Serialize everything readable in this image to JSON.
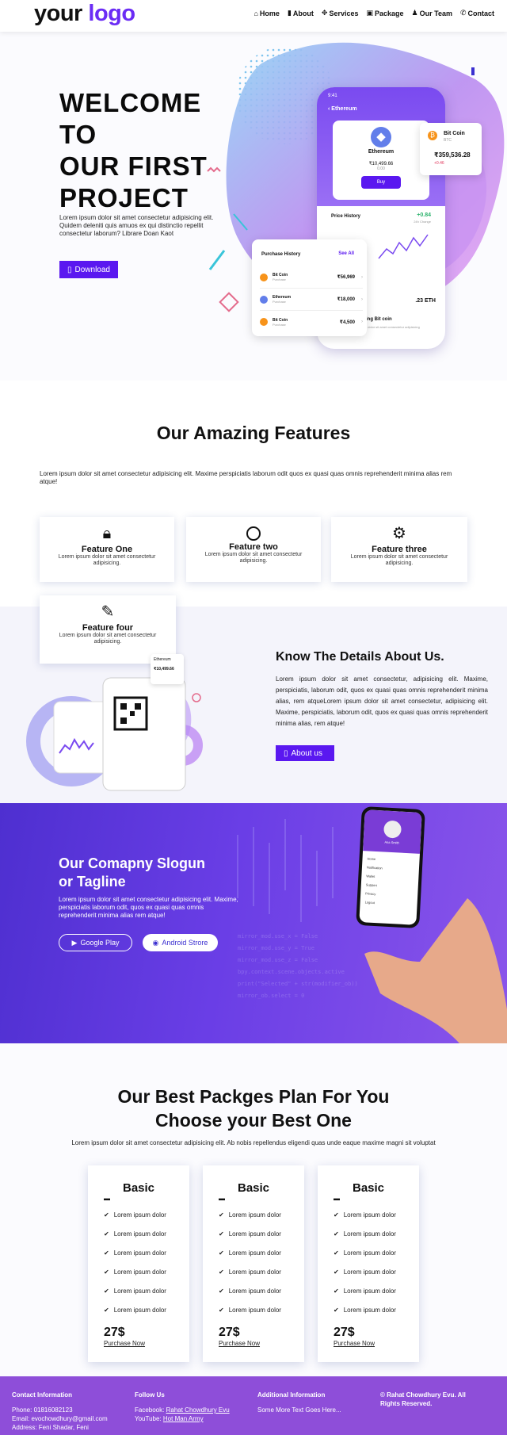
{
  "nav": {
    "logo_part1": "your",
    "logo_part2": "logo",
    "items": [
      "Home",
      "About",
      "Services",
      "Package",
      "Our Team",
      "Contact"
    ]
  },
  "hero": {
    "title_lines": [
      "WELCOME",
      "TO",
      "OUR FIRST",
      "PROJECT"
    ],
    "desc": "Lorem ipsum dolor sit amet consectetur adipisicing elit. Quidem deleniti quis amuos ex qui distinctio repellit consectetur laborum? Librare Doan Kaot",
    "download_label": "Download",
    "phone": {
      "time": "9:41",
      "coin_name": "Ethereum",
      "coin_sub": "Ethereum",
      "coin_price": "₹10,499.66",
      "coin_change": "0.00",
      "buy_label": "Buy",
      "history_label": "Price History",
      "history_value": "+0.84",
      "history_sub": "24h Change",
      "bottom_value": ".23 ETH",
      "bottom_title": "Pre Selling Bit coin",
      "bottom_sub": "Lorem ipsum dolor sit amet consectetur adipisicing"
    },
    "bitcoin_card": {
      "name": "Bit Coin",
      "sub": "BTC",
      "price": "₹359,536.28",
      "change": "+0.46"
    },
    "purchase": {
      "title": "Purchase History",
      "see_all": "See All",
      "rows": [
        {
          "name": "Bit Coin",
          "sub": "Purchase",
          "amount": "₹56,969"
        },
        {
          "name": "Ethereum",
          "sub": "Purchase",
          "amount": "₹18,000"
        },
        {
          "name": "Bit Coin",
          "sub": "Purchase",
          "amount": "₹4,500"
        }
      ]
    }
  },
  "features": {
    "title": "Our Amazing Features",
    "desc": "Lorem ipsum dolor sit amet consectetur adipisicing elit. Maxime perspiciatis laborum odit quos ex quasi quas omnis reprehenderit minima alias rem atque!",
    "cards": [
      {
        "icon": "lock-icon",
        "title": "Feature One",
        "desc": "Lorem ipsum dolor sit amet consectetur adipisicing."
      },
      {
        "icon": "circle-icon",
        "title": "Feature two",
        "desc": "Lorem ipsum dolor sit amet consectetur adipisicing."
      },
      {
        "icon": "gears-icon",
        "title": "Feature three",
        "desc": "Lorem ipsum dolor sit amet consectetur adipisicing."
      },
      {
        "icon": "file-edit-icon",
        "title": "Feature four",
        "desc": "Lorem ipsum dolor sit amet consectetur adipisicing."
      }
    ]
  },
  "details": {
    "title": "Know The Details About Us.",
    "text": "Lorem ipsum dolor sit amet consectetur, adipisicing elit. Maxime, perspiciatis, laborum odit, quos ex quasi quas omnis reprehenderit minima alias, rem atqueLorem ipsum dolor sit amet consectetur, adipisicing elit. Maxime, perspiciatis, laborum odit, quos ex quasi quas omnis reprehenderit minima alias, rem atque!",
    "button_label": "About us",
    "phone_label": "Ethereum",
    "phone_value": "₹10,499.66"
  },
  "slogan": {
    "title_line1": "Our Comapny Slogun",
    "title_line2": "or Tagline",
    "text": "Lorem ipsum dolor sit amet consectetur adipisicing elit. Maxime, perspiciatis laborum odit, quos ex quasi quas omnis reprehenderit minima alias rem atque!",
    "google_label": "Google Play",
    "android_label": "Android Strore",
    "phone_name": "Ana Smith",
    "phone_items": [
      "Home",
      "Notification",
      "Wallet",
      "Support",
      "Privacy",
      "Logout"
    ]
  },
  "pricing": {
    "title_line1": "Our Best Packges Plan For You",
    "title_line2": "Choose your Best One",
    "desc": "Lorem ipsum dolor sit amet consectetur adipisicing elit. Ab nobis repellendus eligendi quas unde eaque maxime magni sit voluptat",
    "plans": [
      {
        "title": "Basic",
        "items": [
          "Lorem ipsum dolor",
          "Lorem ipsum dolor",
          "Lorem ipsum dolor",
          "Lorem ipsum dolor",
          "Lorem ipsum dolor",
          "Lorem ipsum dolor"
        ],
        "price": "27$",
        "link": "Purchase Now"
      },
      {
        "title": "Basic",
        "items": [
          "Lorem ipsum dolor",
          "Lorem ipsum dolor",
          "Lorem ipsum dolor",
          "Lorem ipsum dolor",
          "Lorem ipsum dolor",
          "Lorem ipsum dolor"
        ],
        "price": "27$",
        "link": "Purchase Now"
      },
      {
        "title": "Basic",
        "items": [
          "Lorem ipsum dolor",
          "Lorem ipsum dolor",
          "Lorem ipsum dolor",
          "Lorem ipsum dolor",
          "Lorem ipsum dolor",
          "Lorem ipsum dolor"
        ],
        "price": "27$",
        "link": "Purchase Now"
      }
    ]
  },
  "footer": {
    "contact": {
      "heading": "Contact Information",
      "phone": "Phone: 01816082123",
      "email": "Email: evochowdhury@gmail.com",
      "address": "Address: Feni Shadar, Feni"
    },
    "follow": {
      "heading": "Follow Us",
      "facebook_label": "Facebook:",
      "facebook_link": "Rahat Chowdhury Evu",
      "youtube_label": "YouTube:",
      "youtube_link": "Hot Man Army"
    },
    "additional": {
      "heading": "Additional Information",
      "text": "Some More Text Goes Here..."
    },
    "copyright": "© Rahat Chowdhury Evu. All Rights Reserved."
  },
  "colors": {
    "accent": "#5a18f0",
    "footer": "#8e4ed9",
    "slogan": "#6a3ee6"
  }
}
